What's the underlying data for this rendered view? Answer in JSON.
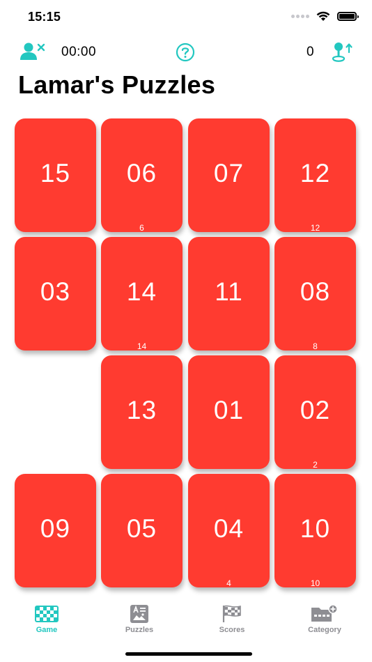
{
  "status_bar": {
    "time": "15:15"
  },
  "toolbar": {
    "timer": "00:00",
    "score": "0",
    "accent_color": "#22c7c0"
  },
  "page_title": "Lamar's Puzzles",
  "tile_color": "#ff3b30",
  "tiles": [
    {
      "label": "15",
      "hint": ""
    },
    {
      "label": "06",
      "hint": "6"
    },
    {
      "label": "07",
      "hint": ""
    },
    {
      "label": "12",
      "hint": "12"
    },
    {
      "label": "03",
      "hint": ""
    },
    {
      "label": "14",
      "hint": "14"
    },
    {
      "label": "11",
      "hint": ""
    },
    {
      "label": "08",
      "hint": "8"
    },
    {
      "label": "13",
      "hint": ""
    },
    {
      "label": "01",
      "hint": ""
    },
    {
      "label": "02",
      "hint": "2"
    },
    {
      "label": "09",
      "hint": ""
    },
    {
      "label": "05",
      "hint": ""
    },
    {
      "label": "04",
      "hint": "4"
    },
    {
      "label": "10",
      "hint": "10"
    }
  ],
  "tab_bar": {
    "items": [
      {
        "label": "Game",
        "icon": "checkerboard-icon",
        "active": true
      },
      {
        "label": "Puzzles",
        "icon": "puzzle-card-icon",
        "active": false
      },
      {
        "label": "Scores",
        "icon": "checkered-flag-icon",
        "active": false
      },
      {
        "label": "Category",
        "icon": "folder-add-icon",
        "active": false
      }
    ]
  }
}
